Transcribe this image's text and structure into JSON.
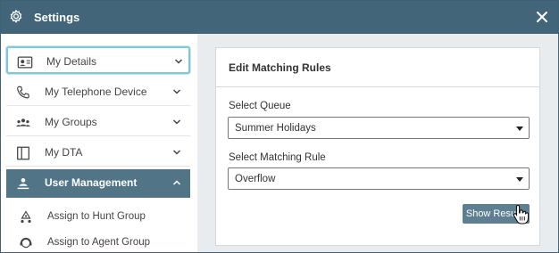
{
  "window": {
    "title": "Settings",
    "icons": {
      "settings": "gear-icon",
      "close": "close-icon"
    }
  },
  "sidebar": {
    "items": [
      {
        "label": "My Details",
        "icon": "id-card-icon",
        "state": "selected"
      },
      {
        "label": "My Telephone Device",
        "icon": "phone-icon",
        "state": "collapsed"
      },
      {
        "label": "My Groups",
        "icon": "group-icon",
        "state": "collapsed"
      },
      {
        "label": "My DTA",
        "icon": "panel-icon",
        "state": "collapsed"
      },
      {
        "label": "User Management",
        "icon": "user-management-icon",
        "state": "expanded"
      }
    ],
    "sub_items": [
      {
        "label": "Assign to Hunt Group",
        "icon": "hunt-group-icon"
      },
      {
        "label": "Assign to Agent Group",
        "icon": "agent-group-icon"
      }
    ]
  },
  "panel": {
    "title": "Edit Matching Rules",
    "queue_label": "Select Queue",
    "queue_value": "Summer Holidays",
    "rule_label": "Select Matching Rule",
    "rule_value": "Overflow",
    "show_results_label": "Show Results"
  },
  "colors": {
    "titlebar": "#426579",
    "active_item": "#517487",
    "button": "#5e7f91",
    "focus_ring": "#7ec8d8",
    "main_background": "#e9ecee"
  }
}
